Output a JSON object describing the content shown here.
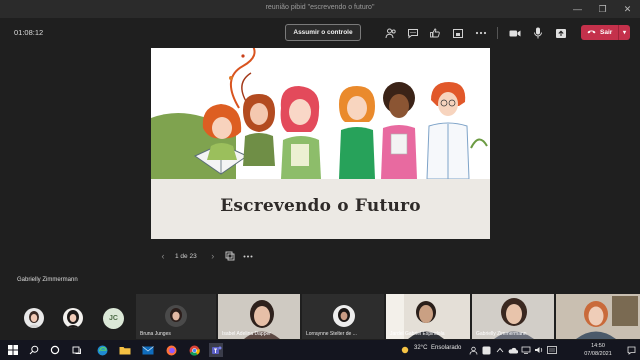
{
  "window": {
    "title": "reunião pibid \"escrevendo o futuro\"",
    "controls": [
      "—",
      "❐",
      "✕"
    ]
  },
  "toolbar": {
    "timer": "01:08:12",
    "take_control_label": "Assumir o controle",
    "leave_label": "Sair",
    "icons": [
      "people-icon",
      "chat-icon",
      "reactions-icon",
      "share-tray-icon",
      "more-icon",
      "camera-icon",
      "mic-icon",
      "share-icon",
      "phone-icon"
    ]
  },
  "slide": {
    "title": "Escrevendo o Futuro",
    "colors": {
      "band": "#ece9e4",
      "hill": "#7fa34f"
    }
  },
  "pager": {
    "prev": "‹",
    "page": "1 de 23",
    "next": "›"
  },
  "presenter": "Gabrielly Zimmermann",
  "participants": {
    "jc_initials": "JC",
    "tiles": [
      {
        "name": "Bruna Junges"
      },
      {
        "name": "Isabel Adelina Dapper"
      },
      {
        "name": "Lorraynne Stelter de ..."
      },
      {
        "name": "Jardel Gabriel Espindola"
      },
      {
        "name": "Gabrielly Zimmermann"
      },
      {
        "name": ""
      }
    ]
  },
  "taskbar": {
    "temperature": "32°C",
    "weather": "Ensolarado",
    "time": "14:50",
    "date": "07/08/2021"
  }
}
